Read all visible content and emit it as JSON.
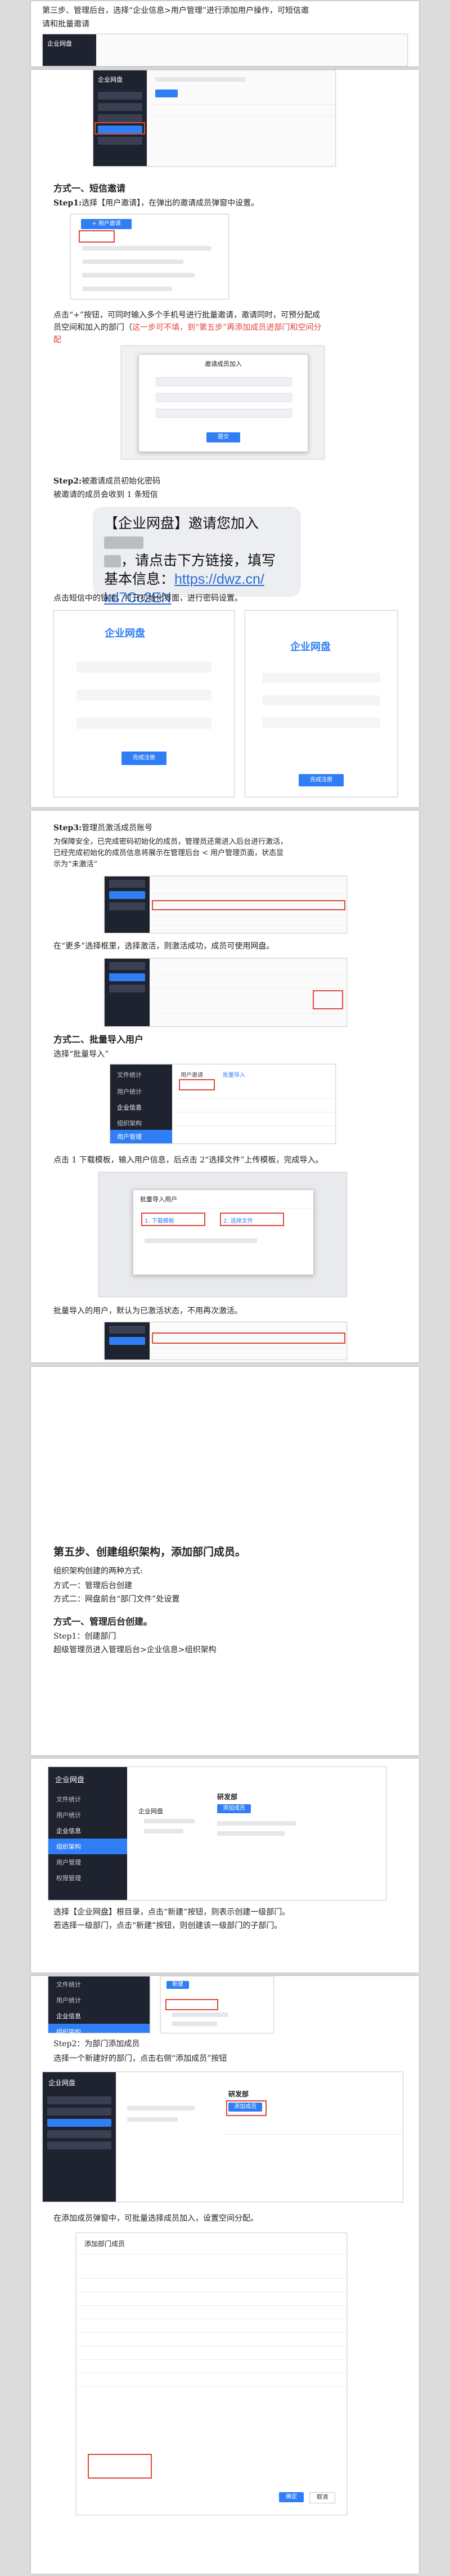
{
  "step3_intro": {
    "line1": "第三步、管理后台，选择“企业信息>用户管理”进行添加用户操作，可短信邀",
    "line2": "请和批量邀请"
  },
  "method1": {
    "title": "方式一、短信邀请",
    "step1_label": "Step1:",
    "step1_text": "选择【用户邀请】，在弹出的邀请成员弹窗中设置。",
    "add_text": "点击“+”按钮，可同时输入多个手机号进行批量邀请，邀请同时，可预分配成",
    "add_text2_a": "员空间和加入的部门（",
    "add_text2_red": "这一步可不填，到“第五步”再添加成员进部门和空间分",
    "add_text3": "配",
    "step2_label": "Step2:",
    "step2_text": "被邀请成员初始化密码",
    "step2_sub": "被邀请的成员会收到 1 条短信",
    "sms_line1": "【企业网盘】邀请您加入",
    "sms_line2": "，请点击下方链接，填写",
    "sms_line3": "基本信息：",
    "sms_link": "https://dwz.cn/",
    "sms_link2": "kd7Cc2EN",
    "click_text": "点击短信中的链接，打开初始化界面，进行密码设置。",
    "step3_label": "Step3:",
    "step3_text": "管理员激活成员账号",
    "step3_p1": "为保障安全，已完成密码初始化的成员，管理员还需进入后台进行激活，",
    "step3_p2": "已经完成初始化的成员信息将展示在管理后台 < 用户管理页面，状态显",
    "step3_p3": "示为“未激活”",
    "activate_text": "在“更多”选择框里，选择激活，则激活成功，成员可使用网盘。"
  },
  "method2": {
    "title": "方式二、批量导入用户",
    "select_text": "选择“批量导入”",
    "download_text": "点击 1 下载模板，输入用户信息，后点击 2“选择文件”上传模板，完成导入。",
    "after_text": "批量导入的用户，默认为已激活状态，不用再次激活。"
  },
  "step5": {
    "title": "第五步、创建组织架构，添加部门成员。",
    "sub": "组织架构创建的两种方式:",
    "opt1": "方式一：管理后台创建",
    "opt2": "方式二：网盘前台“部门文件”处设置",
    "m1_title": "方式一、管理后台创建。",
    "step1": "Step1：创建部门",
    "step1_sub": "超级管理员进入管理后台>企业信息>组织架构",
    "sel_text1": "选择【企业网盘】根目录，点击“新建”按钮，则表示创建一级部门。",
    "sel_text2": "若选择一级部门，点击“新建”按钮，则创建该一级部门的子部门。",
    "step2": "Step2：为部门添加成员",
    "step2_sub": "选择一个新建好的部门，点击右侧“添加成员”按钮",
    "add_text": "在添加成员弹窗中，可批量选择成员加入，设置空间分配。"
  },
  "mock": {
    "app_name": "企业网盘",
    "menu_file": "文件统计",
    "menu_user": "用户统计",
    "menu_info": "企业信息",
    "menu_org": "组织架构",
    "menu_users": "用户管理",
    "menu_perm": "权限管理",
    "invite_btn": "+ 用户邀请",
    "batch_import": "批量导入",
    "user_invite": "用户邀请",
    "invite_title": "邀请成员加入",
    "submit": "提交",
    "init_title": "企业网盘",
    "confirm": "完成注册",
    "new_btn": "新建",
    "add_member": "添加成员",
    "dept": "研发部",
    "org_root": "企业网盘",
    "import_title": "批量导入用户",
    "step_download": "1. 下载模板",
    "step_choose": "2. 选择文件",
    "add_members_title": "添加部门成员",
    "ok": "确定",
    "cancel": "取消"
  }
}
